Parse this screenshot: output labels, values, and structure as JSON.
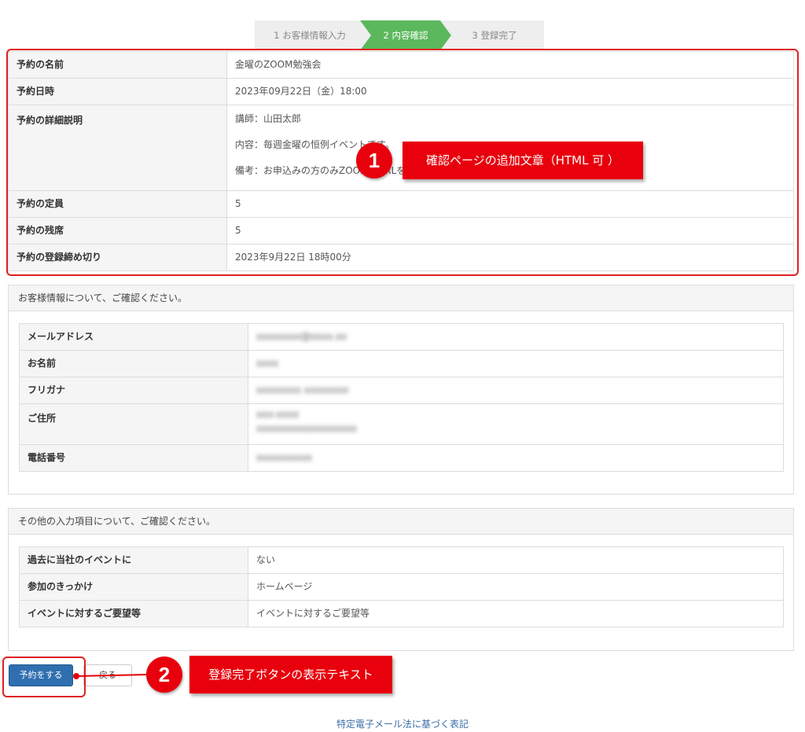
{
  "steps": [
    {
      "label": "1 お客様情報入力",
      "active": false
    },
    {
      "label": "2 内容確認",
      "active": true
    },
    {
      "label": "3 登録完了",
      "active": false
    }
  ],
  "reservation": {
    "rows": [
      {
        "label": "予約の名前",
        "value": "金曜のZOOM勉強会"
      },
      {
        "label": "予約日時",
        "value": "2023年09月22日（金）18:00"
      },
      {
        "label": "予約の詳細説明",
        "lines": [
          "講師：山田太郎",
          "内容：毎週金曜の恒例イベントです。",
          "備考：お申込みの方のみZOOMのURLをお送りします。"
        ]
      },
      {
        "label": "予約の定員",
        "value": "5"
      },
      {
        "label": "予約の残席",
        "value": "5"
      },
      {
        "label": "予約の登録締め切り",
        "value": "2023年9月22日 18時00分"
      }
    ]
  },
  "customer": {
    "heading": "お客様情報について、ご確認ください。",
    "rows": [
      {
        "label": "メールアドレス",
        "value": "xxxxxxxx@xxxx.xx"
      },
      {
        "label": "お名前",
        "value": "xxxx"
      },
      {
        "label": "フリガナ",
        "value": "xxxxxxxx xxxxxxxx"
      },
      {
        "label": "ご住所",
        "lines": [
          "xxx-xxxx",
          "xxxxxxxxxxxxxxxxxx"
        ]
      },
      {
        "label": "電話番号",
        "value": "xxxxxxxxxx"
      }
    ]
  },
  "other": {
    "heading": "その他の入力項目について、ご確認ください。",
    "rows": [
      {
        "label": "過去に当社のイベントに",
        "value": "ない"
      },
      {
        "label": "参加のきっかけ",
        "value": "ホームページ"
      },
      {
        "label": "イベントに対するご要望等",
        "value": "イベントに対するご要望等"
      }
    ]
  },
  "buttons": {
    "submit": "予約をする",
    "back": "戻る"
  },
  "footer": {
    "link": "特定電子メール法に基づく表記"
  },
  "annotations": {
    "n1": "1",
    "label1": "確認ページの追加文章（HTML 可 ）",
    "n2": "2",
    "label2": "登録完了ボタンの表示テキスト"
  },
  "colors": {
    "active_step": "#5cb85c",
    "inactive_step": "#eeeeee",
    "primary_button": "#2f6fb0",
    "annotation_red": "#e8000c"
  }
}
